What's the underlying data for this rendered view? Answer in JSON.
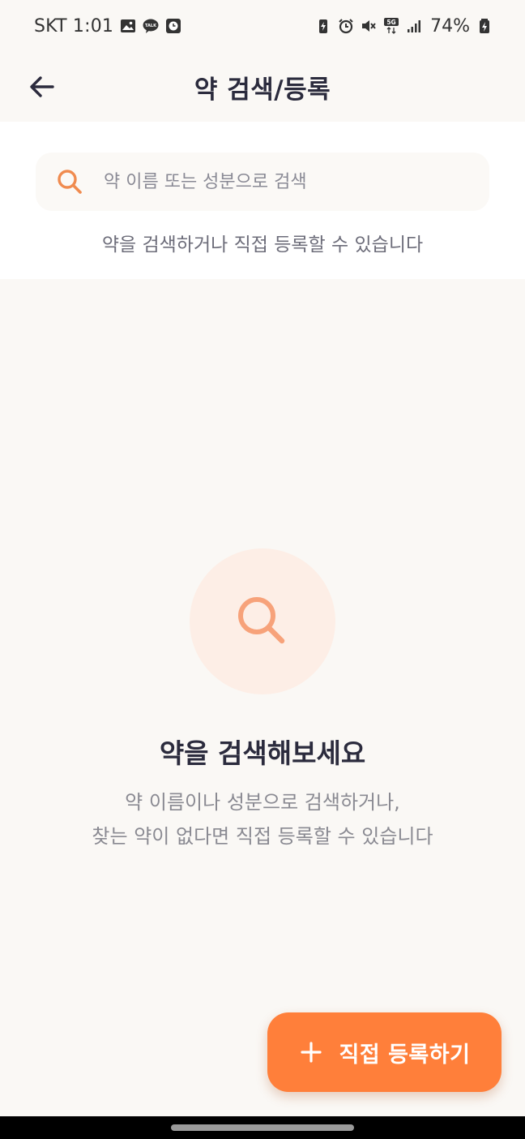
{
  "status_bar": {
    "carrier_time": "SKT 1:01",
    "network": "5G",
    "battery": "74%"
  },
  "header": {
    "title": "약 검색/등록",
    "back_icon": "arrow-left-icon"
  },
  "search": {
    "placeholder": "약 이름 또는 성분으로 검색",
    "value": "",
    "hint": "약을 검색하거나 직접 등록할 수 있습니다",
    "icon": "search-icon"
  },
  "empty_state": {
    "title": "약을 검색해보세요",
    "line1": "약 이름이나 성분으로 검색하거나,",
    "line2": "찾는 약이 없다면 직접 등록할 수 있습니다",
    "icon": "search-icon"
  },
  "fab": {
    "label": "직접 등록하기",
    "icon": "plus-icon"
  },
  "colors": {
    "accent": "#ff7f3a",
    "accent_soft": "#fdeee6",
    "search_icon": "#f08b4f",
    "background": "#faf8f5",
    "title_text": "#2b2b3d"
  }
}
